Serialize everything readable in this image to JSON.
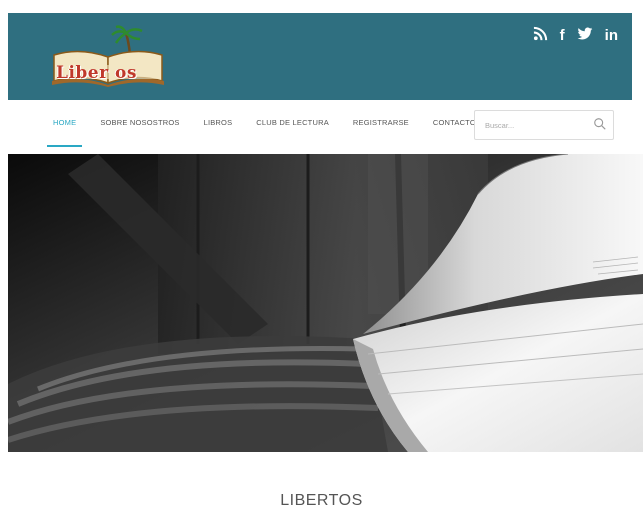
{
  "header": {
    "logo_text": "Liber  os",
    "social": [
      {
        "icon": "rss-icon"
      },
      {
        "icon": "facebook-icon",
        "glyph": "f"
      },
      {
        "icon": "twitter-icon"
      },
      {
        "icon": "linkedin-icon",
        "glyph": "in"
      }
    ],
    "colors": {
      "background": "#2f6f80",
      "accent": "#2aa8c4"
    }
  },
  "nav": {
    "items": [
      {
        "label": "HOME",
        "active": true
      },
      {
        "label": "SOBRE NOSOSTROS"
      },
      {
        "label": "LIBROS"
      },
      {
        "label": "CLUB DE LECTURA"
      },
      {
        "label": "REGISTRARSE"
      },
      {
        "label": "CONTACTO"
      }
    ],
    "search_placeholder": "Buscar..."
  },
  "hero": {
    "image": "black-and-white open book on wooden surface"
  },
  "main": {
    "title": "LIBERTOS"
  }
}
